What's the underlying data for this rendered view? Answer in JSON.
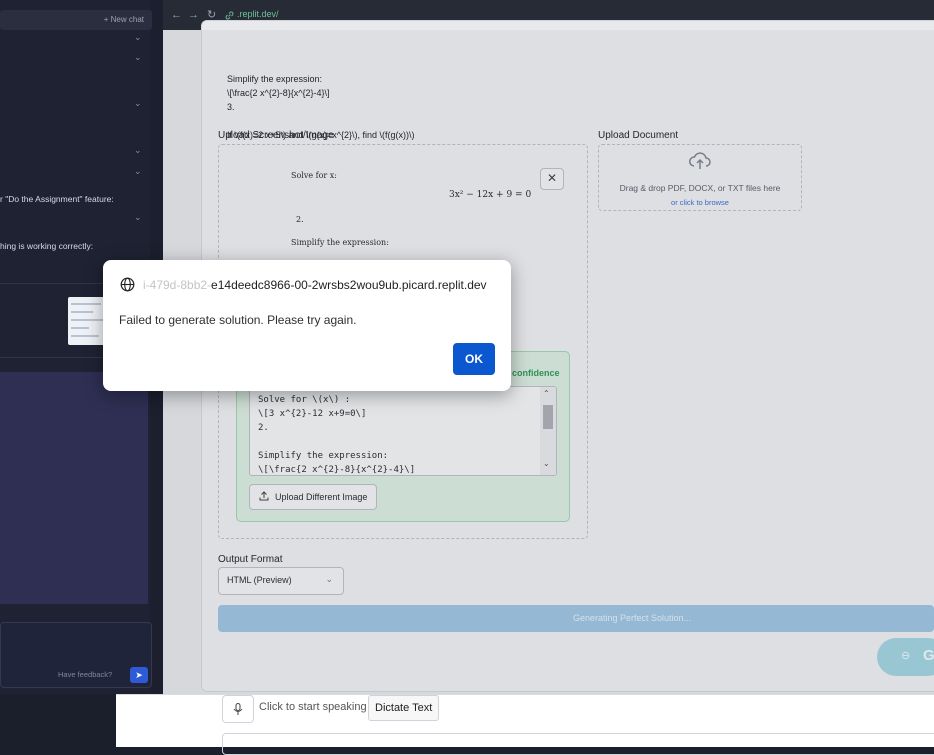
{
  "sidebar": {
    "new_chat_label": "+ New chat",
    "text_assignment": "r \"Do the Assignment\" feature:",
    "text_working": "hing is working correctly:",
    "feedback_label": "Have feedback?"
  },
  "browser": {
    "url": ".replit.dev/"
  },
  "page": {
    "problem_lines": [
      "Simplify the expression:",
      "\\[\\frac{2 x^{2}-8}{x^{2}-4}\\]",
      "3.",
      "If \\(f(x)=2 x+5\\) and \\(g(x)=x^{2}\\), find \\(f(g(x))\\)"
    ],
    "upload_image_label": "Upload Screenshot/Image",
    "upload_document_label": "Upload Document",
    "doc_drop_text": "Drag & drop PDF, DOCX, or TXT files here",
    "doc_browse_text": "or click to browse",
    "preview": {
      "solve_for": "Solve for x:",
      "equation": "3x² − 12x + 9 = 0",
      "item_2": "2.",
      "simplify": "Simplify the expression:"
    },
    "confidence_label": "confidence",
    "ocr_lines": [
      "Solve for \\(x\\) :",
      "\\[3 x^{2}-12 x+9=0\\]",
      "2.",
      "",
      "Simplify the expression:",
      "\\[\\frac{2 x^{2}-8}{x^{2}-4}\\]"
    ],
    "upload_different_label": "Upload Different Image",
    "output_format_label": "Output Format",
    "output_format_value": "HTML (Preview)",
    "generate_label": "Generating Perfect Solution...",
    "float_btn_label": "G"
  },
  "dialog": {
    "origin_faded": "i-479d-8bb2-",
    "origin": "e14deedc8966-00-2wrsbs2wou9ub.picard.replit.dev",
    "message": "Failed to generate solution. Please try again.",
    "ok_label": "OK"
  },
  "bottom_bar": {
    "mic_label": "Click to start speaking",
    "dictate_label": "Dictate Text"
  }
}
